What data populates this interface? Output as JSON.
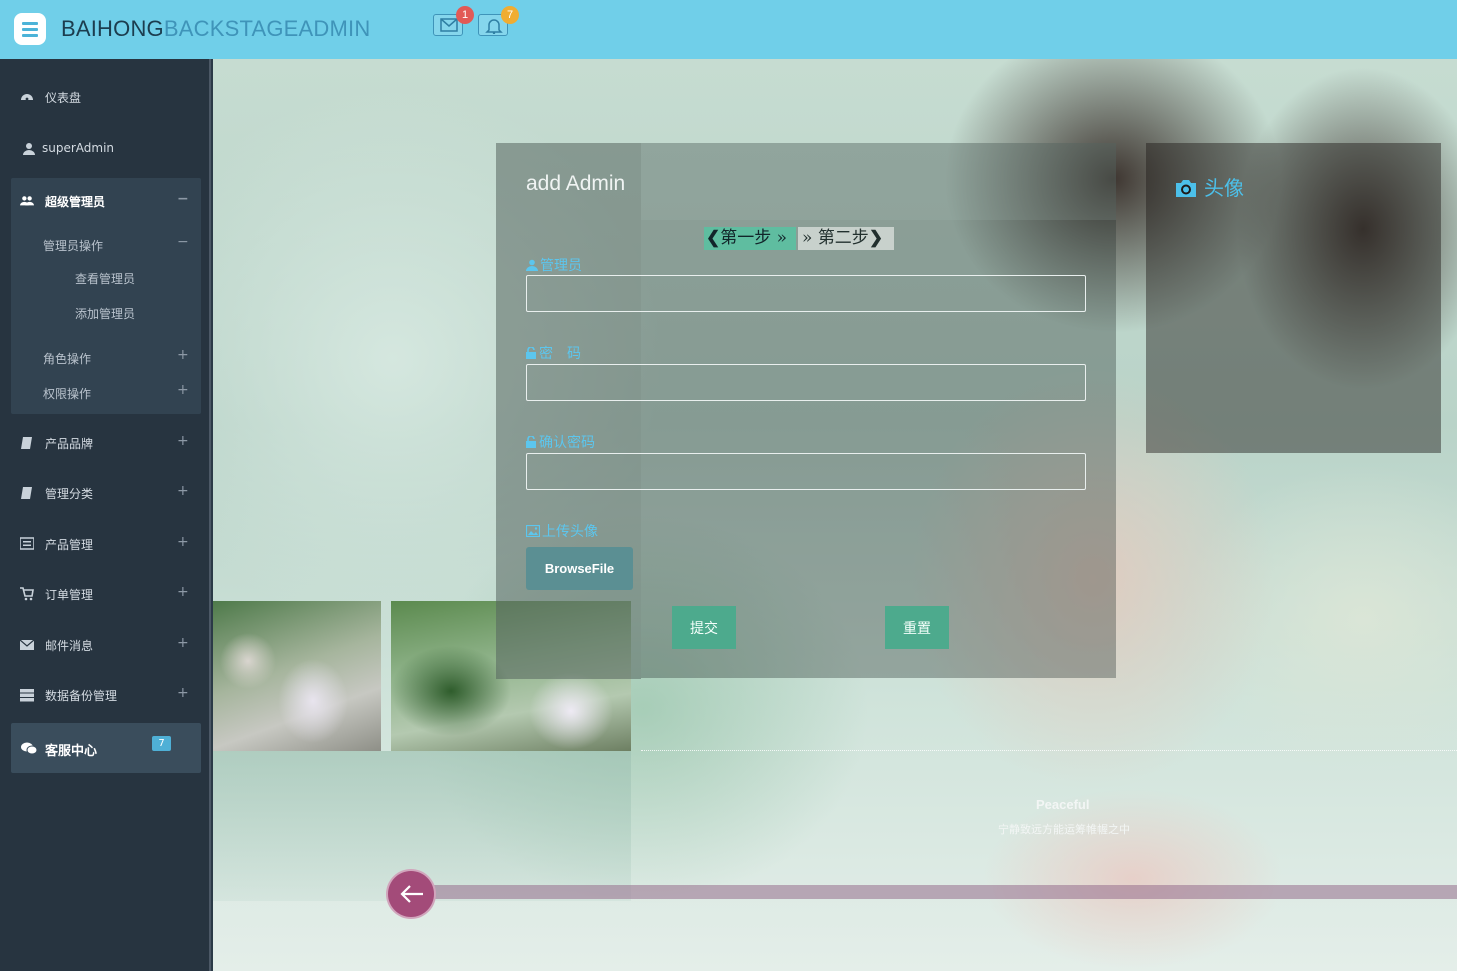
{
  "header": {
    "brand_part1": "BAIHONG",
    "brand_part2": "BACKSTAGEADMIN",
    "mail_count": "1",
    "notification_count": "7",
    "colors": {
      "bar": "#70cfe9",
      "mail_badge": "#e25a56",
      "notification_badge": "#f0ad31"
    }
  },
  "sidebar": {
    "dashboard": "仪表盘",
    "user": "superAdmin",
    "super_admin_group": {
      "label": "超级管理员",
      "toggle": "−",
      "admin_ops": {
        "label": "管理员操作",
        "toggle": "−",
        "view": "查看管理员",
        "add": "添加管理员"
      },
      "role_ops": {
        "label": "角色操作",
        "toggle": "+"
      },
      "perm_ops": {
        "label": "权限操作",
        "toggle": "+"
      }
    },
    "items": [
      {
        "label": "产品品牌",
        "toggle": "+"
      },
      {
        "label": "管理分类",
        "toggle": "+"
      },
      {
        "label": "产品管理",
        "toggle": "+"
      },
      {
        "label": "订单管理",
        "toggle": "+"
      },
      {
        "label": "邮件消息",
        "toggle": "+"
      },
      {
        "label": "数据备份管理",
        "toggle": "+"
      }
    ],
    "customer_service": {
      "label": "客服中心",
      "count": "7"
    }
  },
  "form": {
    "title": "add Admin",
    "step1": "第一步",
    "step2": "第二步",
    "admin_label": "管理员",
    "admin_value": "",
    "password_label": "密　码",
    "password_value": "",
    "confirm_label": "确认密码",
    "confirm_value": "",
    "upload_label": "上传头像",
    "browse_label": "BrowseFile",
    "submit_label": "提交",
    "reset_label": "重置"
  },
  "avatar": {
    "title": "头像"
  },
  "banner": {
    "title": "Peaceful",
    "subtitle": "宁静致远方能运筹帷幄之中"
  }
}
